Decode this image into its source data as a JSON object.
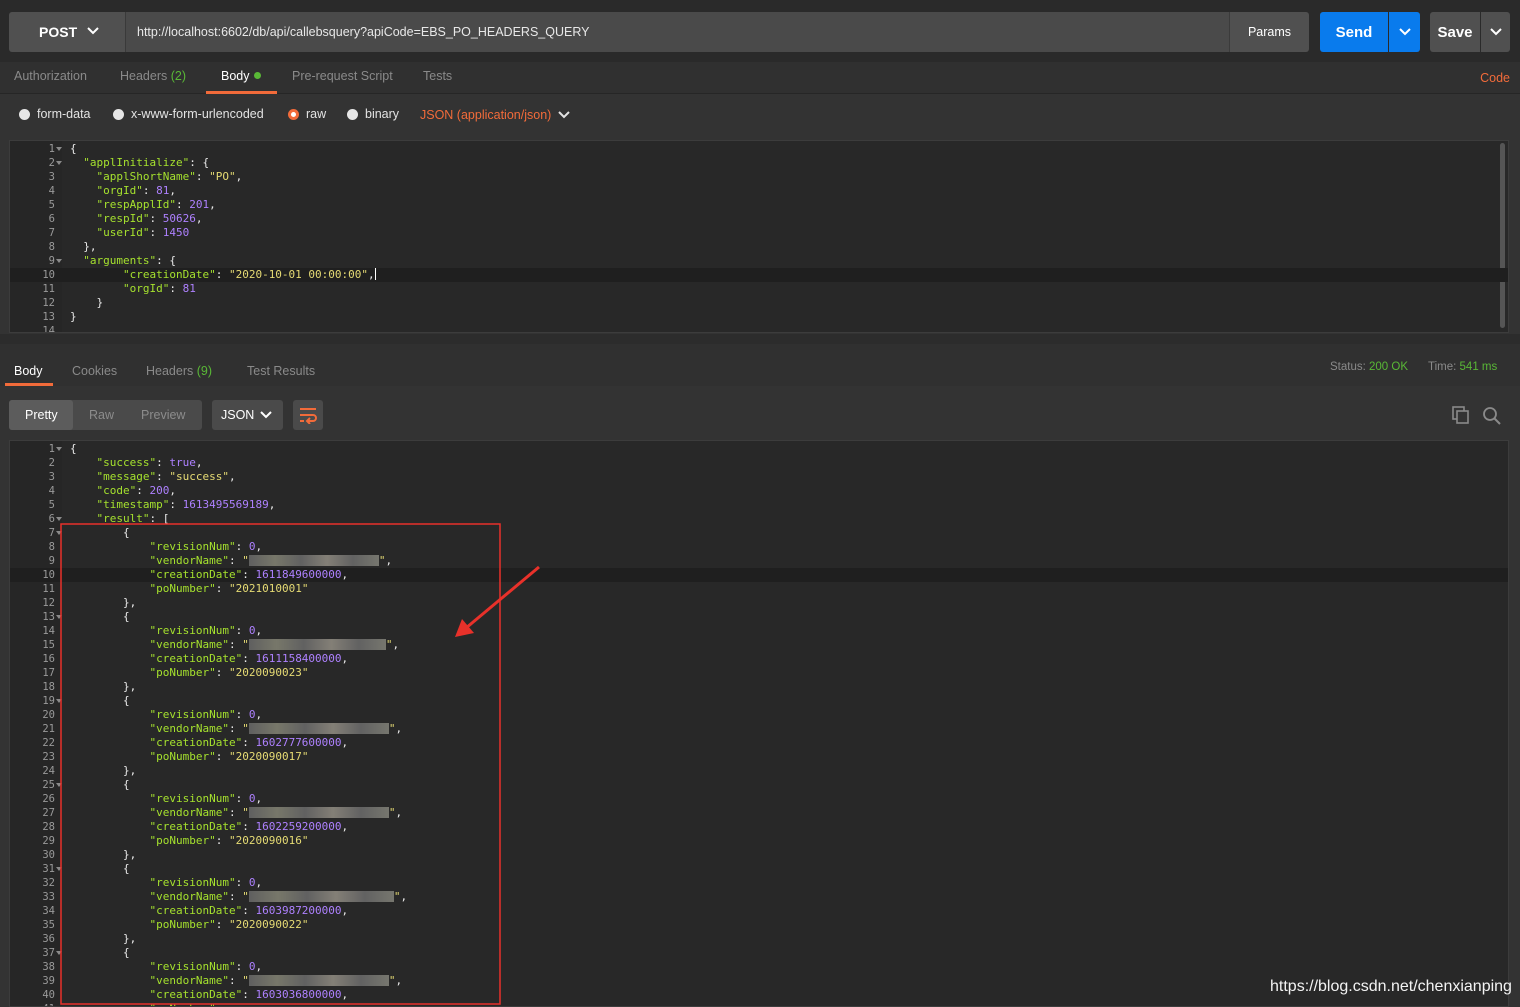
{
  "request": {
    "method": "POST",
    "url": "http://localhost:6602/db/api/callebsquery?apiCode=EBS_PO_HEADERS_QUERY",
    "params_label": "Params",
    "send_label": "Send",
    "save_label": "Save"
  },
  "request_tabs": {
    "authorization": "Authorization",
    "headers": "Headers",
    "headers_count": "(2)",
    "body": "Body",
    "pre_request": "Pre-request Script",
    "tests": "Tests",
    "code": "Code"
  },
  "body_types": {
    "form_data": "form-data",
    "urlencoded": "x-www-form-urlencoded",
    "raw": "raw",
    "binary": "binary",
    "content_type": "JSON (application/json)"
  },
  "request_body": {
    "line_numbers": [
      "1",
      "2",
      "3",
      "4",
      "5",
      "6",
      "7",
      "8",
      "9",
      "10",
      "11",
      "12",
      "13",
      "14"
    ],
    "appl_short_name": "\"PO\"",
    "org_id": "81",
    "resp_appl_id": "201",
    "resp_id": "50626",
    "user_id": "1450",
    "creation_date": "\"2020-10-01 00:00:00\"",
    "arg_org_id": "81"
  },
  "response_tabs": {
    "body": "Body",
    "cookies": "Cookies",
    "headers": "Headers",
    "headers_count": "(9)",
    "test_results": "Test Results",
    "status_label": "Status:",
    "status_value": "200 OK",
    "time_label": "Time:",
    "time_value": "541 ms"
  },
  "response_toolbar": {
    "pretty": "Pretty",
    "raw": "Raw",
    "preview": "Preview",
    "format": "JSON"
  },
  "response_body": {
    "success": "true",
    "message": "\"success\"",
    "code": "200",
    "timestamp": "1613495569189",
    "results": [
      {
        "revisionNum": "0",
        "creationDate": "1611849600000",
        "poNumber": "\"2021010001\""
      },
      {
        "revisionNum": "0",
        "creationDate": "1611158400000",
        "poNumber": "\"2020090023\""
      },
      {
        "revisionNum": "0",
        "creationDate": "1602777600000",
        "poNumber": "\"2020090017\""
      },
      {
        "revisionNum": "0",
        "creationDate": "1602259200000",
        "poNumber": "\"2020090016\""
      },
      {
        "revisionNum": "0",
        "creationDate": "1603987200000",
        "poNumber": "\"2020090022\""
      },
      {
        "revisionNum": "0",
        "creationDate": "1603036800000"
      }
    ]
  },
  "watermark": "https://blog.csdn.net/chenxianping",
  "colors": {
    "accent": "#f26b3a",
    "send_blue": "#097bed",
    "success_green": "#59b836",
    "annotation_red": "#e8312a"
  },
  "icons": [
    "chevron-down-icon",
    "wrap-lines-icon",
    "copy-icon",
    "search-icon",
    "red-arrow-annotation"
  ]
}
